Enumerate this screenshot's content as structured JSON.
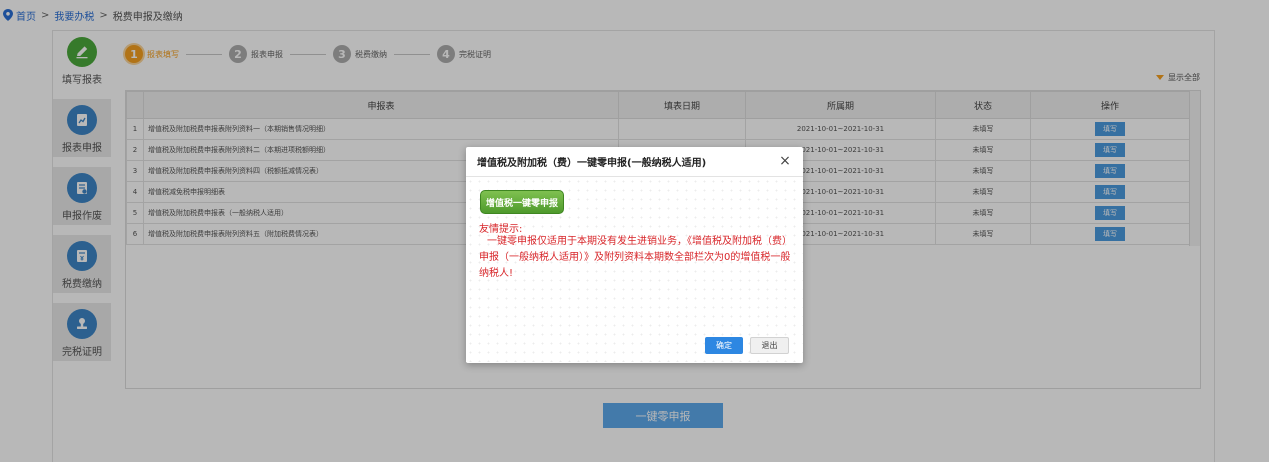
{
  "breadcrumb": {
    "home": "首页",
    "sep1": ">",
    "tax": "我要办税",
    "sep2": ">",
    "current": "税费申报及缴纳"
  },
  "sidebar": {
    "items": [
      {
        "label": "填写报表",
        "icon": "pencil-icon"
      },
      {
        "label": "报表申报",
        "icon": "report-chart-icon"
      },
      {
        "label": "申报作废",
        "icon": "void-document-icon"
      },
      {
        "label": "税费缴纳",
        "icon": "tax-payment-icon"
      },
      {
        "label": "完税证明",
        "icon": "certificate-stamp-icon"
      }
    ]
  },
  "steps": [
    {
      "num": "1",
      "label": "报表填写"
    },
    {
      "num": "2",
      "label": "报表申报"
    },
    {
      "num": "3",
      "label": "税费缴纳"
    },
    {
      "num": "4",
      "label": "完税证明"
    }
  ],
  "show_all": "显示全部",
  "table": {
    "headers": [
      "",
      "申报表",
      "填表日期",
      "所属期",
      "状态",
      "操作"
    ],
    "rows": [
      {
        "num": "1",
        "name": "增值税及附加税费申报表附列资料一（本期销售情况明细）",
        "date": "",
        "period": "2021-10-01~2021-10-31",
        "status": "未填写",
        "action": "填写"
      },
      {
        "num": "2",
        "name": "增值税及附加税费申报表附列资料二（本期进项税额明细）",
        "date": "",
        "period": "2021-10-01~2021-10-31",
        "status": "未填写",
        "action": "填写"
      },
      {
        "num": "3",
        "name": "增值税及附加税费申报表附列资料四（税额抵减情况表）",
        "date": "",
        "period": "2021-10-01~2021-10-31",
        "status": "未填写",
        "action": "填写"
      },
      {
        "num": "4",
        "name": "增值税减免税申报明细表",
        "date": "",
        "period": "2021-10-01~2021-10-31",
        "status": "未填写",
        "action": "填写"
      },
      {
        "num": "5",
        "name": "增值税及附加税费申报表（一般纳税人适用）",
        "date": "",
        "period": "2021-10-01~2021-10-31",
        "status": "未填写",
        "action": "填写"
      },
      {
        "num": "6",
        "name": "增值税及附加税费申报表附列资料五（附加税费情况表）",
        "date": "",
        "period": "2021-10-01~2021-10-31",
        "status": "未填写",
        "action": "填写"
      }
    ]
  },
  "zero_declare_button": "一键零申报",
  "modal": {
    "title": "增值税及附加税（费）一键零申报(一般纳税人适用)",
    "close": "×",
    "vat_button": "增值税一键零申报",
    "tip_title": "友情提示:",
    "tip_text": "一键零申报仅适用于本期没有发生进销业务，《增值税及附加税（费）申报（一般纳税人适用）》及附列资料本期数全部栏次为0的增值税一般纳税人!",
    "ok": "确定",
    "exit": "退出"
  },
  "colors": {
    "accent_orange": "#f5a020",
    "primary_blue": "#2d87e2",
    "fill_button_blue": "#4b9be0",
    "tip_red": "#d8262a",
    "vat_green": "#4e9a2c"
  }
}
